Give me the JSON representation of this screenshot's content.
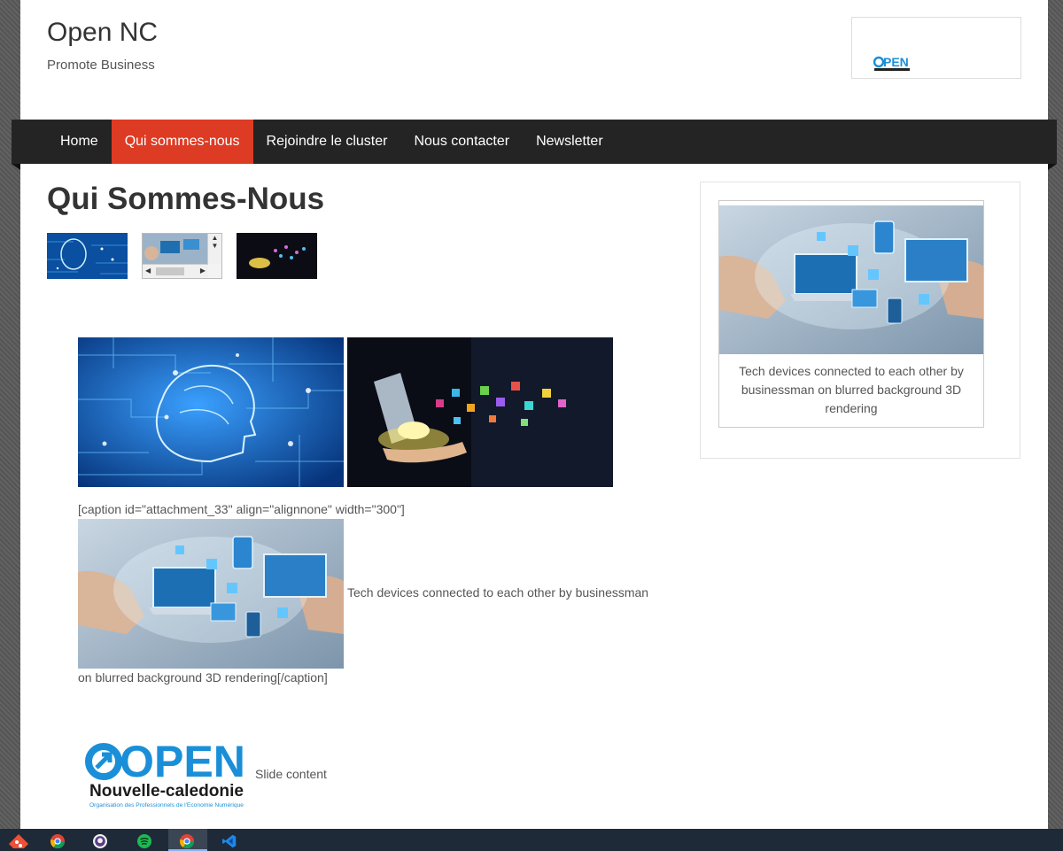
{
  "site": {
    "title": "Open NC",
    "tagline": "Promote Business"
  },
  "nav": {
    "items": [
      {
        "label": "Home"
      },
      {
        "label": "Qui sommes-nous"
      },
      {
        "label": "Rejoindre le cluster"
      },
      {
        "label": "Nous contacter"
      },
      {
        "label": "Newsletter"
      }
    ],
    "active_index": 1
  },
  "colors": {
    "accent": "#dd3b23",
    "nav_bg": "#242424",
    "logo_blue": "#1a8fd8"
  },
  "main": {
    "title": "Qui Sommes-Nous",
    "caption_open": "[caption id=\"attachment_33\" align=\"alignnone\" width=\"300\"]",
    "caption_inline": "Tech devices connected to each other by businessman",
    "caption_close": "on blurred background 3D rendering[/caption]",
    "slide_text": "Slide content"
  },
  "logo": {
    "word": "OPEN",
    "region": "Nouvelle-caledonie",
    "subline": "Organisation des Professionnels de l'Economie Numérique"
  },
  "sidebar": {
    "figure_caption": "Tech devices connected to each other by businessman on blurred background 3D rendering"
  },
  "taskbar": {
    "apps": [
      "git-icon",
      "chrome-icon",
      "github-icon",
      "spotify-icon",
      "chrome-active-icon",
      "vscode-icon"
    ]
  }
}
